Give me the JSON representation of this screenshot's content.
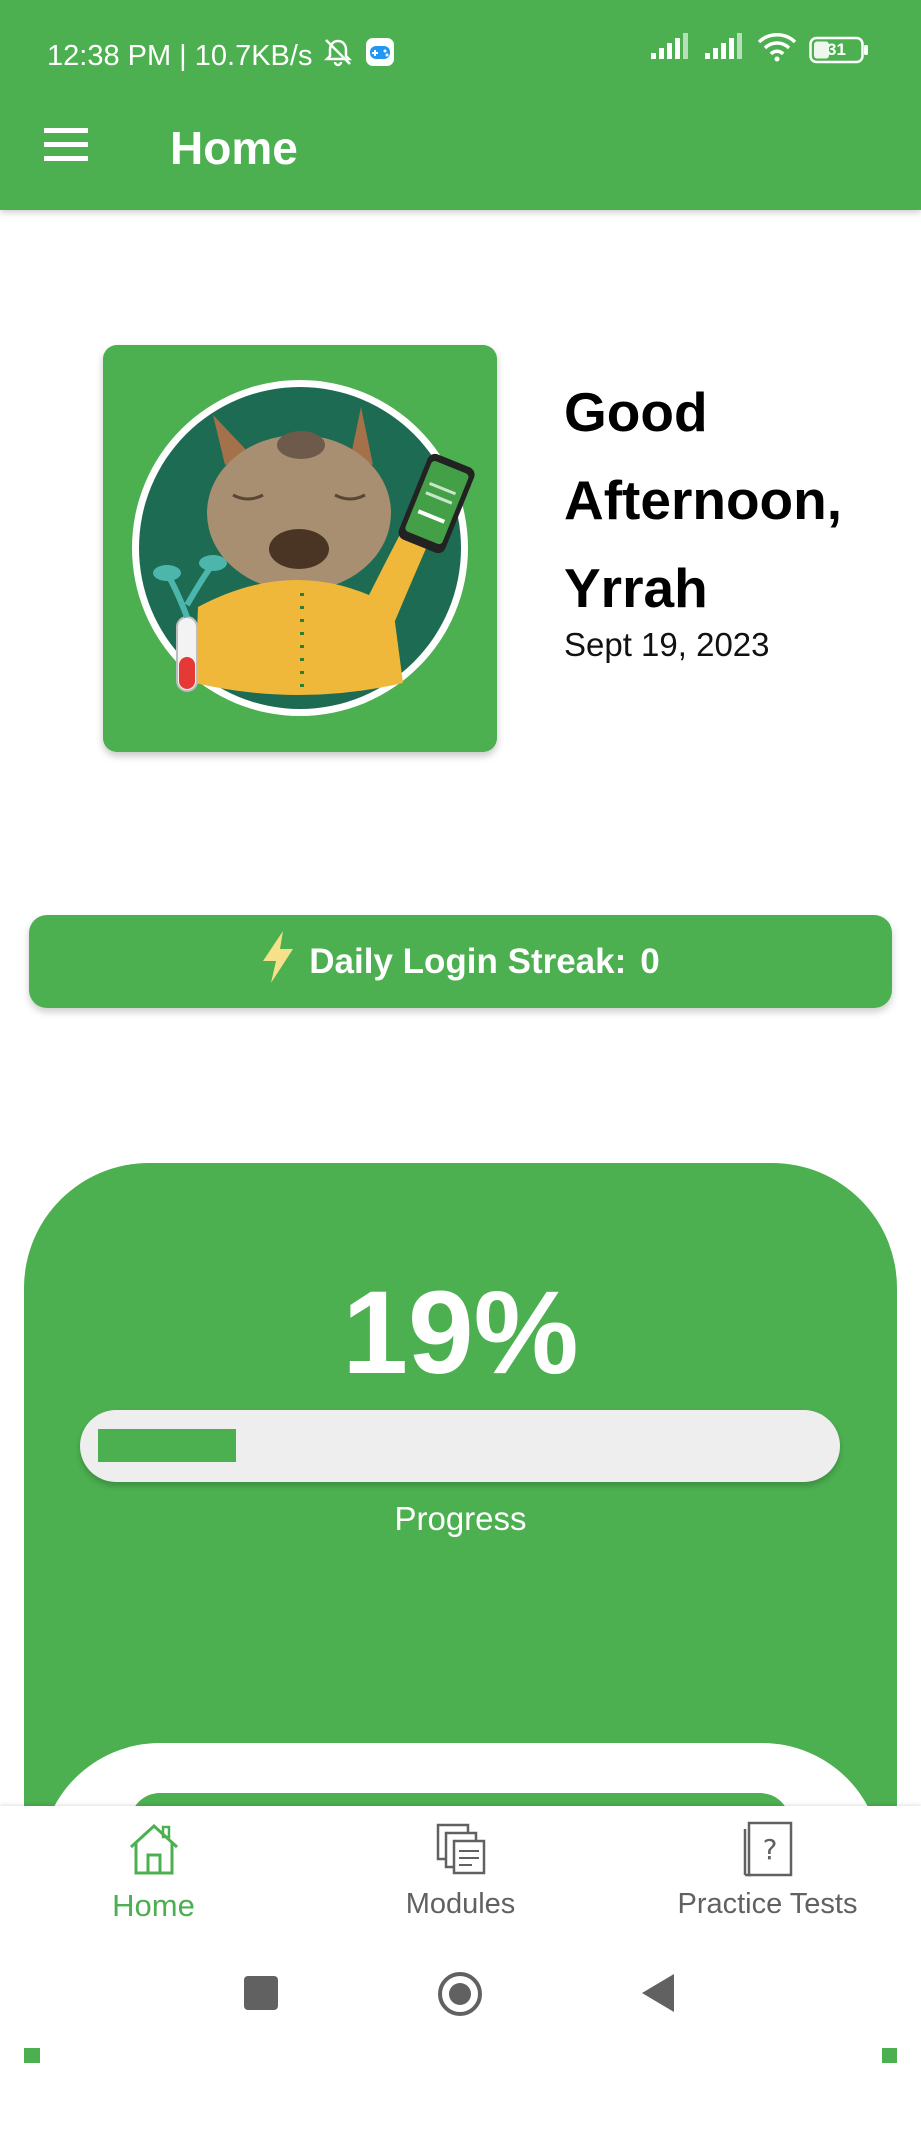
{
  "status_bar": {
    "time_speed": "12:38 PM | 10.7KB/s",
    "battery": "31"
  },
  "app_bar": {
    "title": "Home"
  },
  "profile": {
    "greeting_line1": "Good",
    "greeting_line2": "Afternoon,",
    "greeting_line3": "Yrrah",
    "date": "Sept 19, 2023"
  },
  "streak": {
    "label": "Daily Login Streak:",
    "value": "0"
  },
  "progress": {
    "percent_text": "19%",
    "fraction": 0.19,
    "label": "Progress"
  },
  "bottom_nav": {
    "items": [
      {
        "label": "Home",
        "icon": "home-icon",
        "active": true
      },
      {
        "label": "Modules",
        "icon": "modules-icon",
        "active": false
      },
      {
        "label": "Practice Tests",
        "icon": "practice-tests-icon",
        "active": false
      }
    ]
  },
  "colors": {
    "primary": "#4caf50",
    "panel_track": "#eeeeee",
    "inactive_nav": "#616161"
  }
}
